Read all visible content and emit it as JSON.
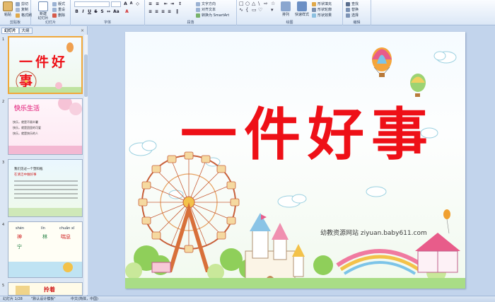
{
  "ribbon": {
    "clipboard": {
      "paste": "粘贴",
      "cut": "剪切",
      "copy": "复制",
      "format_painter": "格式刷",
      "group": "剪贴板"
    },
    "slides": {
      "new_slide": "新建\n幻灯片",
      "layout": "版式",
      "reset": "重设",
      "delete": "删除",
      "group": "幻灯片"
    },
    "font": {
      "font_name": "",
      "font_size": "",
      "group": "字体"
    },
    "paragraph": {
      "text_direction": "文字方向",
      "align_text": "对齐文本",
      "smartart": "转换为 SmartArt",
      "group": "段落"
    },
    "drawing": {
      "arrange": "排列",
      "quick_styles": "快速样式",
      "shape_fill": "形状填充",
      "shape_outline": "形状轮廓",
      "shape_effects": "形状效果",
      "group": "绘图"
    },
    "editing": {
      "find": "查找",
      "replace": "替换",
      "select": "选择",
      "group": "编辑"
    }
  },
  "left_pane": {
    "tab_slides": "幻灯片",
    "tab_outline": "大纲",
    "close": "×",
    "thumbs": [
      {
        "num": "1",
        "title": "一件好事"
      },
      {
        "num": "2",
        "title": "快乐生活",
        "lines": [
          "快乐，就是不顾炎暑",
          "快乐，就是团里的可爱",
          "快乐，就是快乐的人"
        ]
      },
      {
        "num": "3",
        "lines": [
          "我们见过一个塑料瓶",
          "在清洁中做好事"
        ]
      },
      {
        "num": "4",
        "words": [
          "shén",
          "lín",
          "chuǎn xī",
          "神",
          "林",
          "喘息",
          "宁"
        ]
      },
      {
        "num": "5",
        "title": "拎着"
      }
    ]
  },
  "slide": {
    "title_chars": [
      "一",
      "件",
      "好",
      "事"
    ],
    "watermark": "幼教资源网站  ziyuan.baby611.com"
  },
  "status_bar": {
    "slide_info": "幻灯片 1/28",
    "theme": "\"默认设计模板\"",
    "language": "中文(简体，中国)"
  },
  "colors": {
    "title_red": "#ee1017",
    "ribbon_bg": "#dbe7f6",
    "pane_bg": "#dbe6f4"
  }
}
